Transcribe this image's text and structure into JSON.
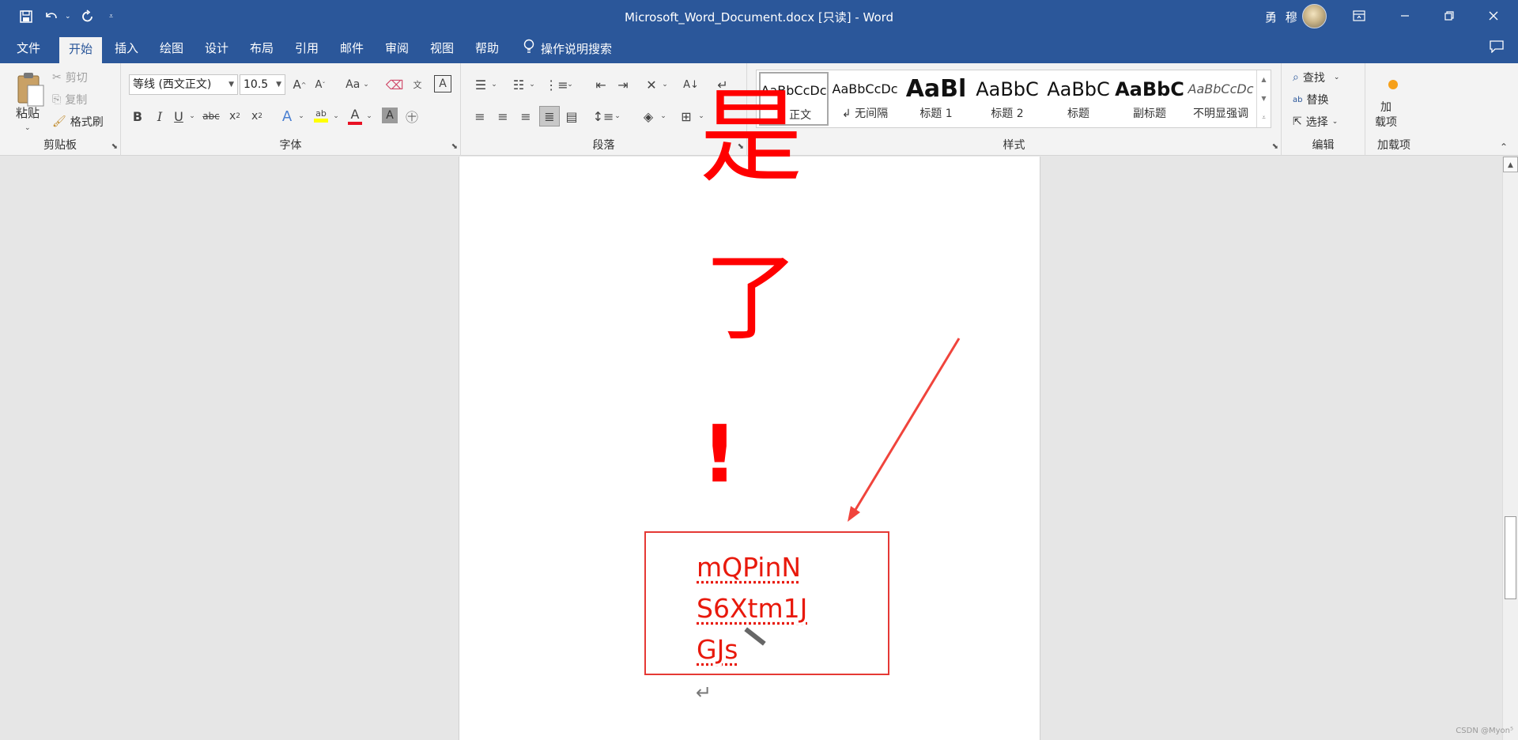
{
  "app": {
    "title": "Microsoft_Word_Document.docx [只读]  -  Word",
    "user_name": "勇 穆",
    "icons": [
      "save-icon",
      "undo-icon",
      "redo-icon",
      "customize-qat-icon",
      "ribbon-display-options-icon",
      "minimize-icon",
      "restore-icon",
      "close-icon"
    ]
  },
  "tabs": [
    "文件",
    "开始",
    "插入",
    "绘图",
    "设计",
    "布局",
    "引用",
    "邮件",
    "审阅",
    "视图",
    "帮助"
  ],
  "active_tab": "开始",
  "tell_me": "操作说明搜索",
  "ribbon": {
    "clipboard": {
      "label": "剪贴板",
      "paste": "粘贴",
      "cut": "剪切",
      "copy": "复制",
      "format_painter": "格式刷"
    },
    "font": {
      "label": "字体",
      "font_name": "等线 (西文正文)",
      "font_size": "10.5",
      "change_case": "Aa",
      "font_color": "#e81123",
      "highlight_color": "#ffff00"
    },
    "paragraph": {
      "label": "段落"
    },
    "styles": {
      "label": "样式",
      "items": [
        {
          "sample": "AaBbCcDc",
          "name": "↲ 正文"
        },
        {
          "sample": "AaBbCcDc",
          "name": "↲ 无间隔"
        },
        {
          "sample": "AaBl",
          "name": "标题 1"
        },
        {
          "sample": "AaBbC",
          "name": "标题 2"
        },
        {
          "sample": "AaBbC",
          "name": "标题"
        },
        {
          "sample": "AaBbC",
          "name": "副标题"
        },
        {
          "sample": "AaBbCcDc",
          "name": "不明显强调"
        }
      ]
    },
    "editing": {
      "label": "编辑",
      "find": "查找",
      "replace": "替换",
      "select": "选择"
    },
    "addins": {
      "label": "加载项",
      "button": "加\n载项"
    }
  },
  "document": {
    "big_chars": [
      "是",
      "了",
      "!"
    ],
    "text_lines": [
      "mQPinN",
      "S6Xtm1J",
      "GJs"
    ],
    "paragraph_mark": "↵",
    "text_color": "#ff0000",
    "annotation_color": "#e53935"
  },
  "watermark": "CSDN @Myon⁵"
}
